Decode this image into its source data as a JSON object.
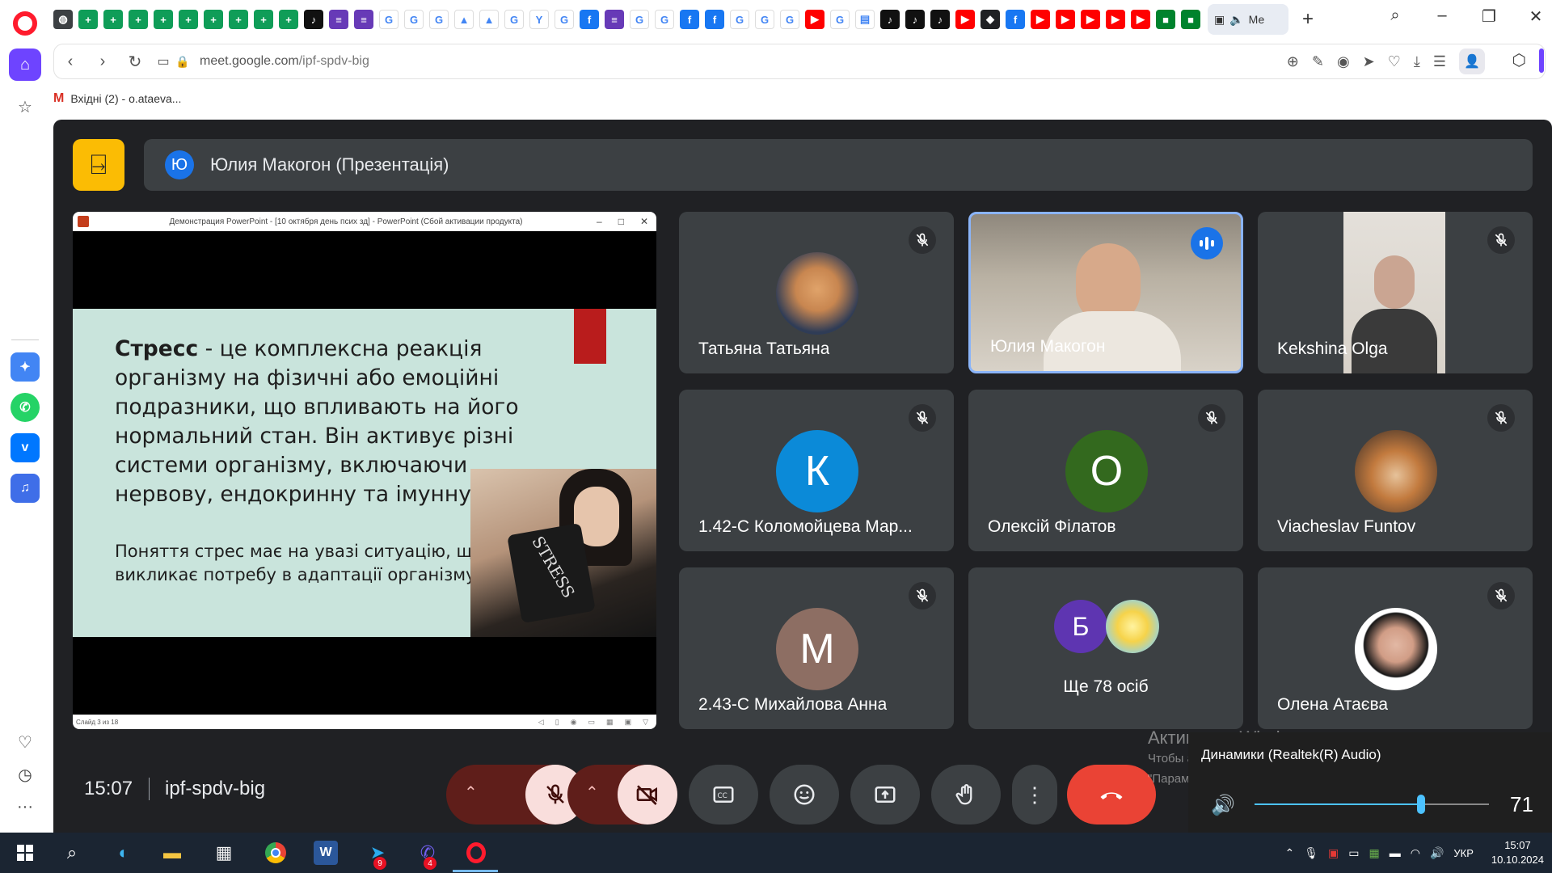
{
  "browser": {
    "tabs_favicons": [
      {
        "icon": "globe-icon",
        "color": "#3c4043",
        "glyph": "◍"
      },
      {
        "icon": "sheets-icon",
        "color": "#0f9d58",
        "glyph": "+"
      },
      {
        "icon": "sheets-icon",
        "color": "#0f9d58",
        "glyph": "+"
      },
      {
        "icon": "sheets-icon",
        "color": "#0f9d58",
        "glyph": "+"
      },
      {
        "icon": "sheets-icon",
        "color": "#0f9d58",
        "glyph": "+"
      },
      {
        "icon": "sheets-icon",
        "color": "#0f9d58",
        "glyph": "+"
      },
      {
        "icon": "sheets-icon",
        "color": "#0f9d58",
        "glyph": "+"
      },
      {
        "icon": "sheets-icon",
        "color": "#0f9d58",
        "glyph": "+"
      },
      {
        "icon": "sheets-icon",
        "color": "#0f9d58",
        "glyph": "+"
      },
      {
        "icon": "sheets-icon",
        "color": "#0f9d58",
        "glyph": "+"
      },
      {
        "icon": "tiktok-icon",
        "color": "#111111",
        "glyph": "♪"
      },
      {
        "icon": "forms-icon",
        "color": "#673ab7",
        "glyph": "≡"
      },
      {
        "icon": "forms-icon",
        "color": "#673ab7",
        "glyph": "≡"
      },
      {
        "icon": "google-icon",
        "color": "#ffffff",
        "glyph": "G"
      },
      {
        "icon": "google-icon",
        "color": "#ffffff",
        "glyph": "G"
      },
      {
        "icon": "google-icon",
        "color": "#ffffff",
        "glyph": "G"
      },
      {
        "icon": "drive-icon",
        "color": "#ffffff",
        "glyph": "▲"
      },
      {
        "icon": "drive-icon",
        "color": "#ffffff",
        "glyph": "▲"
      },
      {
        "icon": "google-icon",
        "color": "#ffffff",
        "glyph": "G"
      },
      {
        "icon": "yandex-icon",
        "color": "#ffffff",
        "glyph": "Y"
      },
      {
        "icon": "google-icon",
        "color": "#ffffff",
        "glyph": "G"
      },
      {
        "icon": "facebook-icon",
        "color": "#1877f2",
        "glyph": "f"
      },
      {
        "icon": "forms-icon",
        "color": "#673ab7",
        "glyph": "≡"
      },
      {
        "icon": "google-icon",
        "color": "#ffffff",
        "glyph": "G"
      },
      {
        "icon": "google-icon",
        "color": "#ffffff",
        "glyph": "G"
      },
      {
        "icon": "facebook-icon",
        "color": "#1877f2",
        "glyph": "f"
      },
      {
        "icon": "facebook-icon",
        "color": "#1877f2",
        "glyph": "f"
      },
      {
        "icon": "google-icon",
        "color": "#ffffff",
        "glyph": "G"
      },
      {
        "icon": "google-icon",
        "color": "#ffffff",
        "glyph": "G"
      },
      {
        "icon": "google-icon",
        "color": "#ffffff",
        "glyph": "G"
      },
      {
        "icon": "youtube-icon",
        "color": "#ff0000",
        "glyph": "▶"
      },
      {
        "icon": "google-icon",
        "color": "#ffffff",
        "glyph": "G"
      },
      {
        "icon": "document-icon",
        "color": "#ffffff",
        "glyph": "▤"
      },
      {
        "icon": "tiktok-icon",
        "color": "#111111",
        "glyph": "♪"
      },
      {
        "icon": "tiktok-icon",
        "color": "#111111",
        "glyph": "♪"
      },
      {
        "icon": "tiktok-icon",
        "color": "#111111",
        "glyph": "♪"
      },
      {
        "icon": "youtube-icon",
        "color": "#ff0000",
        "glyph": "▶"
      },
      {
        "icon": "shield-icon",
        "color": "#202124",
        "glyph": "◆"
      },
      {
        "icon": "facebook-icon",
        "color": "#1877f2",
        "glyph": "f"
      },
      {
        "icon": "youtube-icon",
        "color": "#ff0000",
        "glyph": "▶"
      },
      {
        "icon": "youtube-icon",
        "color": "#ff0000",
        "glyph": "▶"
      },
      {
        "icon": "youtube-icon",
        "color": "#ff0000",
        "glyph": "▶"
      },
      {
        "icon": "youtube-icon",
        "color": "#ff0000",
        "glyph": "▶"
      },
      {
        "icon": "youtube-icon",
        "color": "#ff0000",
        "glyph": "▶"
      },
      {
        "icon": "meet-icon",
        "color": "#00832d",
        "glyph": "■"
      },
      {
        "icon": "meet-icon",
        "color": "#00832d",
        "glyph": "■"
      }
    ],
    "active_tab_label": "Ме",
    "url_host": "meet.google.com",
    "url_path": "/ipf-spdv-big",
    "bookmark_label": "Вхідні (2) - o.ataeva..."
  },
  "meet": {
    "presenter_avatar_letter": "Ю",
    "presenter_title": "Юлия Макогон (Презентація)",
    "presentation": {
      "window_title": "Демонстрация PowerPoint - [10 октября день псих зд] - PowerPoint (Сбой активации продукта)",
      "slide_lead_bold": "Стресс",
      "slide_lead_text": " - це комплексна реакція організму на фізичні або емоційні подразники, що впливають на його нормальний стан. Він активує різні системи організму, включаючи нервову, ендокринну та імунну.",
      "slide_sub_text": "Поняття стрес має на увазі ситуацію, що викликає потребу в адаптації організму.",
      "mug_label": "STRESS",
      "status_text": "Слайд 3 из 18"
    },
    "participants": [
      {
        "name": "Татьяна Татьяна",
        "avatar": "kitten-photo",
        "muted": true
      },
      {
        "name": "Юлия Макогон",
        "avatar": "video",
        "muted": false,
        "speaking": true
      },
      {
        "name": "Kekshina Olga",
        "avatar": "video",
        "muted": true
      },
      {
        "name": "1.42-С Коломойцева Мар...",
        "avatar_letter": "К",
        "avatar_color": "#0b8ad8",
        "muted": true
      },
      {
        "name": "Олексій Філатов",
        "avatar_letter": "О",
        "avatar_color": "#33691e",
        "muted": true
      },
      {
        "name": "Viacheslav Funtov",
        "avatar": "dog-photo",
        "muted": true
      },
      {
        "name": "2.43-С Михайлова Анна",
        "avatar_letter": "М",
        "avatar_color": "#8d6e63",
        "muted": true
      },
      {
        "name": "Ще 78 осіб",
        "avatar_letter": "Б",
        "avatar_color": "#5e35b1"
      },
      {
        "name": "Олена Атаєва",
        "avatar": "woman-photo",
        "muted": true
      }
    ],
    "time": "15:07",
    "meeting_code": "ipf-spdv-big"
  },
  "windows": {
    "activation_title": "Активация Windows",
    "activation_desc": "Чтобы активировать Windows, перейдите в раздел \"Параметры\".",
    "volume_device": "Динамики (Realtek(R) Audio)",
    "volume_level": 71,
    "taskbar_badges": {
      "telegram": "9",
      "viber": "4"
    },
    "language": "УКР",
    "clock_time": "15:07",
    "clock_date": "10.10.2024"
  },
  "colors": {
    "meet_bg": "#202124",
    "tile_bg": "#3c4043",
    "accent_blue": "#1a73e8",
    "end_call_red": "#ea4335",
    "opera_red": "#ff1b2d",
    "opera_purple": "#6e44ff"
  }
}
